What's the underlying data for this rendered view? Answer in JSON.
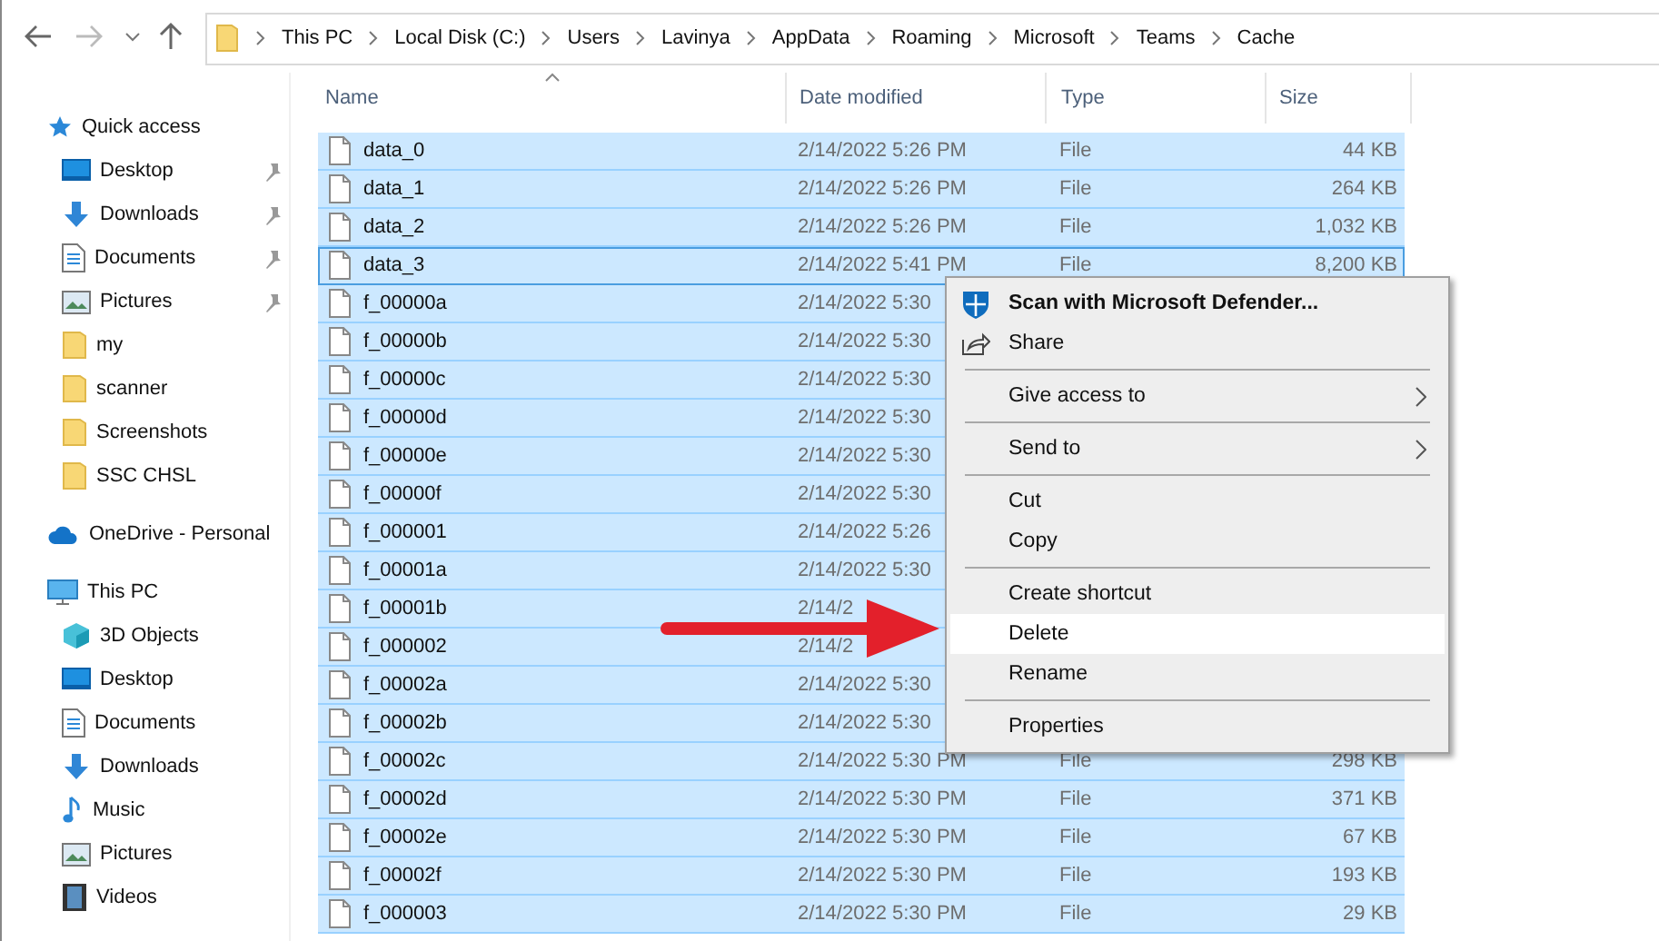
{
  "breadcrumb": [
    "This PC",
    "Local Disk (C:)",
    "Users",
    "Lavinya",
    "AppData",
    "Roaming",
    "Microsoft",
    "Teams",
    "Cache"
  ],
  "sidebar": [
    {
      "label": "Quick access",
      "kind": "star",
      "children": [
        {
          "label": "Desktop",
          "kind": "desktop",
          "pinned": true
        },
        {
          "label": "Downloads",
          "kind": "downloads",
          "pinned": true
        },
        {
          "label": "Documents",
          "kind": "documents",
          "pinned": true
        },
        {
          "label": "Pictures",
          "kind": "pictures",
          "pinned": true
        },
        {
          "label": "my",
          "kind": "folder",
          "pinned": false
        },
        {
          "label": "scanner",
          "kind": "folder",
          "pinned": false
        },
        {
          "label": "Screenshots",
          "kind": "folder",
          "pinned": false
        },
        {
          "label": "SSC CHSL",
          "kind": "folder",
          "pinned": false
        }
      ]
    },
    {
      "label": "OneDrive - Personal",
      "kind": "cloud"
    },
    {
      "label": "This PC",
      "kind": "pc",
      "children": [
        {
          "label": "3D Objects",
          "kind": "cube",
          "pinned": false
        },
        {
          "label": "Desktop",
          "kind": "desktop",
          "pinned": false
        },
        {
          "label": "Documents",
          "kind": "documents",
          "pinned": false
        },
        {
          "label": "Downloads",
          "kind": "downloads",
          "pinned": false
        },
        {
          "label": "Music",
          "kind": "music",
          "pinned": false
        },
        {
          "label": "Pictures",
          "kind": "pictures",
          "pinned": false
        },
        {
          "label": "Videos",
          "kind": "videos",
          "pinned": false
        }
      ]
    }
  ],
  "columns": [
    {
      "label": "Name",
      "sorted": true
    },
    {
      "label": "Date modified",
      "sorted": false
    },
    {
      "label": "Type",
      "sorted": false
    },
    {
      "label": "Size",
      "sorted": false
    }
  ],
  "rows": [
    {
      "name": "data_0",
      "date": "2/14/2022 5:26 PM",
      "type": "File",
      "size": "44 KB",
      "selected": true,
      "focused": false
    },
    {
      "name": "data_1",
      "date": "2/14/2022 5:26 PM",
      "type": "File",
      "size": "264 KB",
      "selected": true,
      "focused": false
    },
    {
      "name": "data_2",
      "date": "2/14/2022 5:26 PM",
      "type": "File",
      "size": "1,032 KB",
      "selected": true,
      "focused": false
    },
    {
      "name": "data_3",
      "date": "2/14/2022 5:41 PM",
      "type": "File",
      "size": "8,200 KB",
      "selected": true,
      "focused": true
    },
    {
      "name": "f_00000a",
      "date": "2/14/2022 5:30",
      "selected": true,
      "focused": false
    },
    {
      "name": "f_00000b",
      "date": "2/14/2022 5:30",
      "selected": true,
      "focused": false
    },
    {
      "name": "f_00000c",
      "date": "2/14/2022 5:30",
      "selected": true,
      "focused": false
    },
    {
      "name": "f_00000d",
      "date": "2/14/2022 5:30",
      "selected": true,
      "focused": false
    },
    {
      "name": "f_00000e",
      "date": "2/14/2022 5:30",
      "selected": true,
      "focused": false
    },
    {
      "name": "f_00000f",
      "date": "2/14/2022 5:30",
      "selected": true,
      "focused": false
    },
    {
      "name": "f_000001",
      "date": "2/14/2022 5:26",
      "selected": true,
      "focused": false
    },
    {
      "name": "f_00001a",
      "date": "2/14/2022 5:30",
      "selected": true,
      "focused": false
    },
    {
      "name": "f_00001b",
      "date": "2/14/2",
      "selected": true,
      "focused": false
    },
    {
      "name": "f_000002",
      "date": "2/14/2",
      "selected": true,
      "focused": false
    },
    {
      "name": "f_00002a",
      "date": "2/14/2022 5:30",
      "selected": true,
      "focused": false
    },
    {
      "name": "f_00002b",
      "date": "2/14/2022 5:30",
      "selected": true,
      "focused": false
    },
    {
      "name": "f_00002c",
      "date": "2/14/2022 5:30 PM",
      "type": "File",
      "size": "298 KB",
      "selected": true,
      "focused": false
    },
    {
      "name": "f_00002d",
      "date": "2/14/2022 5:30 PM",
      "type": "File",
      "size": "371 KB",
      "selected": true,
      "focused": false
    },
    {
      "name": "f_00002e",
      "date": "2/14/2022 5:30 PM",
      "type": "File",
      "size": "67 KB",
      "selected": true,
      "focused": false
    },
    {
      "name": "f_00002f",
      "date": "2/14/2022 5:30 PM",
      "type": "File",
      "size": "193 KB",
      "selected": true,
      "focused": false
    },
    {
      "name": "f_000003",
      "date": "2/14/2022 5:30 PM",
      "type": "File",
      "size": "29 KB",
      "selected": true,
      "focused": false
    }
  ],
  "context_menu": [
    {
      "kind": "scan",
      "label": "Scan with Microsoft Defender...",
      "bold": true,
      "submenu": false,
      "selected": false
    },
    {
      "kind": "share",
      "label": "Share",
      "bold": false,
      "submenu": false,
      "selected": false
    },
    {
      "kind": "separator"
    },
    {
      "kind": "item",
      "label": "Give access to",
      "bold": false,
      "submenu": true,
      "selected": false
    },
    {
      "kind": "separator"
    },
    {
      "kind": "item",
      "label": "Send to",
      "bold": false,
      "submenu": true,
      "selected": false
    },
    {
      "kind": "separator"
    },
    {
      "kind": "item",
      "label": "Cut",
      "bold": false,
      "submenu": false,
      "selected": false
    },
    {
      "kind": "item",
      "label": "Copy",
      "bold": false,
      "submenu": false,
      "selected": false
    },
    {
      "kind": "separator"
    },
    {
      "kind": "item",
      "label": "Create shortcut",
      "bold": false,
      "submenu": false,
      "selected": false
    },
    {
      "kind": "item",
      "label": "Delete",
      "bold": false,
      "submenu": false,
      "selected": true
    },
    {
      "kind": "item",
      "label": "Rename",
      "bold": false,
      "submenu": false,
      "selected": false
    },
    {
      "kind": "separator"
    },
    {
      "kind": "item",
      "label": "Properties",
      "bold": false,
      "submenu": false,
      "selected": false
    }
  ],
  "annotation": {
    "kind": "arrow"
  }
}
